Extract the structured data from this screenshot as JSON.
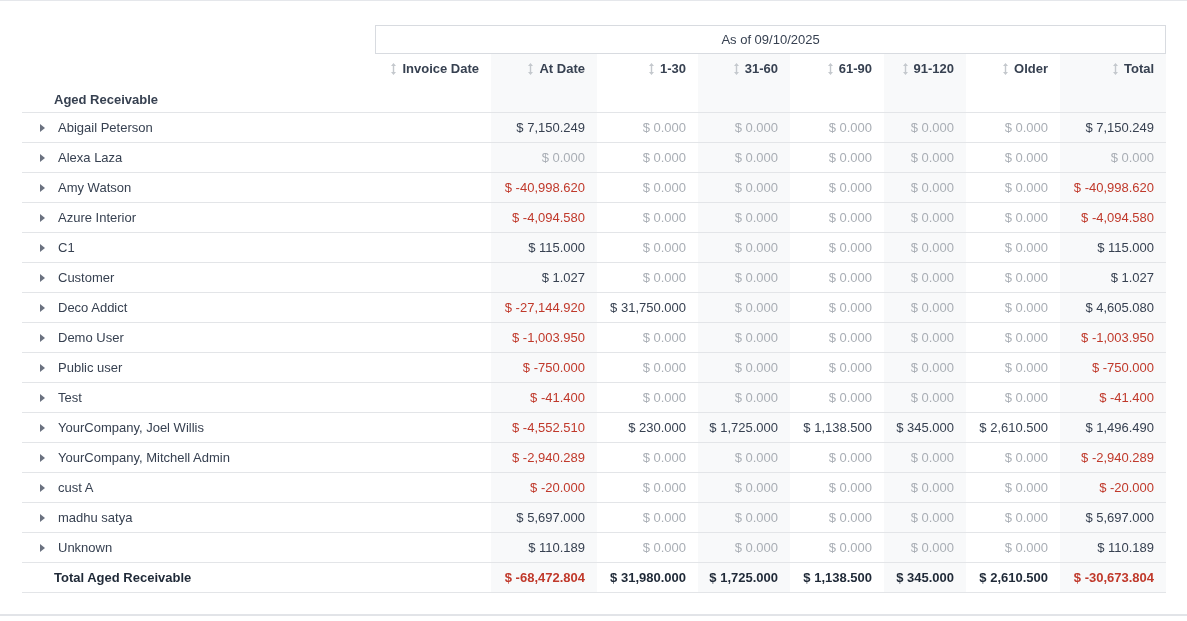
{
  "report": {
    "period_header": "As of 09/10/2025",
    "columns": [
      {
        "label": "Invoice Date"
      },
      {
        "label": "At Date"
      },
      {
        "label": "1-30"
      },
      {
        "label": "31-60"
      },
      {
        "label": "61-90"
      },
      {
        "label": "91-120"
      },
      {
        "label": "Older"
      },
      {
        "label": "Total"
      }
    ],
    "section_title": "Aged Receivable",
    "rows": [
      {
        "name": "Abigail Peterson",
        "expanded": false,
        "cells": [
          {},
          {
            "value": "$ 7,150.249",
            "kind": "pos"
          },
          {
            "value": "$ 0.000",
            "kind": "zero"
          },
          {
            "value": "$ 0.000",
            "kind": "zero"
          },
          {
            "value": "$ 0.000",
            "kind": "zero"
          },
          {
            "value": "$ 0.000",
            "kind": "zero"
          },
          {
            "value": "$ 0.000",
            "kind": "zero"
          },
          {
            "value": "$ 7,150.249",
            "kind": "pos"
          }
        ]
      },
      {
        "name": "Alexa Laza",
        "expanded": false,
        "cells": [
          {},
          {
            "value": "$ 0.000",
            "kind": "zero"
          },
          {
            "value": "$ 0.000",
            "kind": "zero"
          },
          {
            "value": "$ 0.000",
            "kind": "zero"
          },
          {
            "value": "$ 0.000",
            "kind": "zero"
          },
          {
            "value": "$ 0.000",
            "kind": "zero"
          },
          {
            "value": "$ 0.000",
            "kind": "zero"
          },
          {
            "value": "$ 0.000",
            "kind": "zero"
          }
        ]
      },
      {
        "name": "Amy Watson",
        "expanded": false,
        "cells": [
          {},
          {
            "value": "$ -40,998.620",
            "kind": "neg"
          },
          {
            "value": "$ 0.000",
            "kind": "zero"
          },
          {
            "value": "$ 0.000",
            "kind": "zero"
          },
          {
            "value": "$ 0.000",
            "kind": "zero"
          },
          {
            "value": "$ 0.000",
            "kind": "zero"
          },
          {
            "value": "$ 0.000",
            "kind": "zero"
          },
          {
            "value": "$ -40,998.620",
            "kind": "neg"
          }
        ]
      },
      {
        "name": "Azure Interior",
        "expanded": false,
        "cells": [
          {},
          {
            "value": "$ -4,094.580",
            "kind": "neg"
          },
          {
            "value": "$ 0.000",
            "kind": "zero"
          },
          {
            "value": "$ 0.000",
            "kind": "zero"
          },
          {
            "value": "$ 0.000",
            "kind": "zero"
          },
          {
            "value": "$ 0.000",
            "kind": "zero"
          },
          {
            "value": "$ 0.000",
            "kind": "zero"
          },
          {
            "value": "$ -4,094.580",
            "kind": "neg"
          }
        ]
      },
      {
        "name": "C1",
        "expanded": false,
        "cells": [
          {},
          {
            "value": "$ 115.000",
            "kind": "pos"
          },
          {
            "value": "$ 0.000",
            "kind": "zero"
          },
          {
            "value": "$ 0.000",
            "kind": "zero"
          },
          {
            "value": "$ 0.000",
            "kind": "zero"
          },
          {
            "value": "$ 0.000",
            "kind": "zero"
          },
          {
            "value": "$ 0.000",
            "kind": "zero"
          },
          {
            "value": "$ 115.000",
            "kind": "pos"
          }
        ]
      },
      {
        "name": "Customer",
        "expanded": false,
        "cells": [
          {},
          {
            "value": "$ 1.027",
            "kind": "pos"
          },
          {
            "value": "$ 0.000",
            "kind": "zero"
          },
          {
            "value": "$ 0.000",
            "kind": "zero"
          },
          {
            "value": "$ 0.000",
            "kind": "zero"
          },
          {
            "value": "$ 0.000",
            "kind": "zero"
          },
          {
            "value": "$ 0.000",
            "kind": "zero"
          },
          {
            "value": "$ 1.027",
            "kind": "pos"
          }
        ]
      },
      {
        "name": "Deco Addict",
        "expanded": false,
        "cells": [
          {},
          {
            "value": "$ -27,144.920",
            "kind": "neg"
          },
          {
            "value": "$ 31,750.000",
            "kind": "pos"
          },
          {
            "value": "$ 0.000",
            "kind": "zero"
          },
          {
            "value": "$ 0.000",
            "kind": "zero"
          },
          {
            "value": "$ 0.000",
            "kind": "zero"
          },
          {
            "value": "$ 0.000",
            "kind": "zero"
          },
          {
            "value": "$ 4,605.080",
            "kind": "pos"
          }
        ]
      },
      {
        "name": "Demo User",
        "expanded": false,
        "cells": [
          {},
          {
            "value": "$ -1,003.950",
            "kind": "neg"
          },
          {
            "value": "$ 0.000",
            "kind": "zero"
          },
          {
            "value": "$ 0.000",
            "kind": "zero"
          },
          {
            "value": "$ 0.000",
            "kind": "zero"
          },
          {
            "value": "$ 0.000",
            "kind": "zero"
          },
          {
            "value": "$ 0.000",
            "kind": "zero"
          },
          {
            "value": "$ -1,003.950",
            "kind": "neg"
          }
        ]
      },
      {
        "name": "Public user",
        "expanded": false,
        "cells": [
          {},
          {
            "value": "$ -750.000",
            "kind": "neg"
          },
          {
            "value": "$ 0.000",
            "kind": "zero"
          },
          {
            "value": "$ 0.000",
            "kind": "zero"
          },
          {
            "value": "$ 0.000",
            "kind": "zero"
          },
          {
            "value": "$ 0.000",
            "kind": "zero"
          },
          {
            "value": "$ 0.000",
            "kind": "zero"
          },
          {
            "value": "$ -750.000",
            "kind": "neg"
          }
        ]
      },
      {
        "name": "Test",
        "expanded": false,
        "cells": [
          {},
          {
            "value": "$ -41.400",
            "kind": "neg"
          },
          {
            "value": "$ 0.000",
            "kind": "zero"
          },
          {
            "value": "$ 0.000",
            "kind": "zero"
          },
          {
            "value": "$ 0.000",
            "kind": "zero"
          },
          {
            "value": "$ 0.000",
            "kind": "zero"
          },
          {
            "value": "$ 0.000",
            "kind": "zero"
          },
          {
            "value": "$ -41.400",
            "kind": "neg"
          }
        ]
      },
      {
        "name": "YourCompany, Joel Willis",
        "expanded": false,
        "cells": [
          {},
          {
            "value": "$ -4,552.510",
            "kind": "neg"
          },
          {
            "value": "$ 230.000",
            "kind": "pos"
          },
          {
            "value": "$ 1,725.000",
            "kind": "pos"
          },
          {
            "value": "$ 1,138.500",
            "kind": "pos"
          },
          {
            "value": "$ 345.000",
            "kind": "pos"
          },
          {
            "value": "$ 2,610.500",
            "kind": "pos"
          },
          {
            "value": "$ 1,496.490",
            "kind": "pos"
          }
        ]
      },
      {
        "name": "YourCompany, Mitchell Admin",
        "expanded": false,
        "cells": [
          {},
          {
            "value": "$ -2,940.289",
            "kind": "neg"
          },
          {
            "value": "$ 0.000",
            "kind": "zero"
          },
          {
            "value": "$ 0.000",
            "kind": "zero"
          },
          {
            "value": "$ 0.000",
            "kind": "zero"
          },
          {
            "value": "$ 0.000",
            "kind": "zero"
          },
          {
            "value": "$ 0.000",
            "kind": "zero"
          },
          {
            "value": "$ -2,940.289",
            "kind": "neg"
          }
        ]
      },
      {
        "name": "cust A",
        "expanded": false,
        "cells": [
          {},
          {
            "value": "$ -20.000",
            "kind": "neg"
          },
          {
            "value": "$ 0.000",
            "kind": "zero"
          },
          {
            "value": "$ 0.000",
            "kind": "zero"
          },
          {
            "value": "$ 0.000",
            "kind": "zero"
          },
          {
            "value": "$ 0.000",
            "kind": "zero"
          },
          {
            "value": "$ 0.000",
            "kind": "zero"
          },
          {
            "value": "$ -20.000",
            "kind": "neg"
          }
        ]
      },
      {
        "name": "madhu satya",
        "expanded": false,
        "cells": [
          {},
          {
            "value": "$ 5,697.000",
            "kind": "pos"
          },
          {
            "value": "$ 0.000",
            "kind": "zero"
          },
          {
            "value": "$ 0.000",
            "kind": "zero"
          },
          {
            "value": "$ 0.000",
            "kind": "zero"
          },
          {
            "value": "$ 0.000",
            "kind": "zero"
          },
          {
            "value": "$ 0.000",
            "kind": "zero"
          },
          {
            "value": "$ 5,697.000",
            "kind": "pos"
          }
        ]
      },
      {
        "name": "Unknown",
        "expanded": false,
        "cells": [
          {},
          {
            "value": "$ 110.189",
            "kind": "pos"
          },
          {
            "value": "$ 0.000",
            "kind": "zero"
          },
          {
            "value": "$ 0.000",
            "kind": "zero"
          },
          {
            "value": "$ 0.000",
            "kind": "zero"
          },
          {
            "value": "$ 0.000",
            "kind": "zero"
          },
          {
            "value": "$ 0.000",
            "kind": "zero"
          },
          {
            "value": "$ 110.189",
            "kind": "pos"
          }
        ]
      }
    ],
    "total": {
      "label": "Total Aged Receivable",
      "cells": [
        {},
        {
          "value": "$ -68,472.804",
          "kind": "neg"
        },
        {
          "value": "$ 31,980.000",
          "kind": "pos"
        },
        {
          "value": "$ 1,725.000",
          "kind": "pos"
        },
        {
          "value": "$ 1,138.500",
          "kind": "pos"
        },
        {
          "value": "$ 345.000",
          "kind": "pos"
        },
        {
          "value": "$ 2,610.500",
          "kind": "pos"
        },
        {
          "value": "$ -30,673.804",
          "kind": "neg"
        }
      ]
    }
  }
}
